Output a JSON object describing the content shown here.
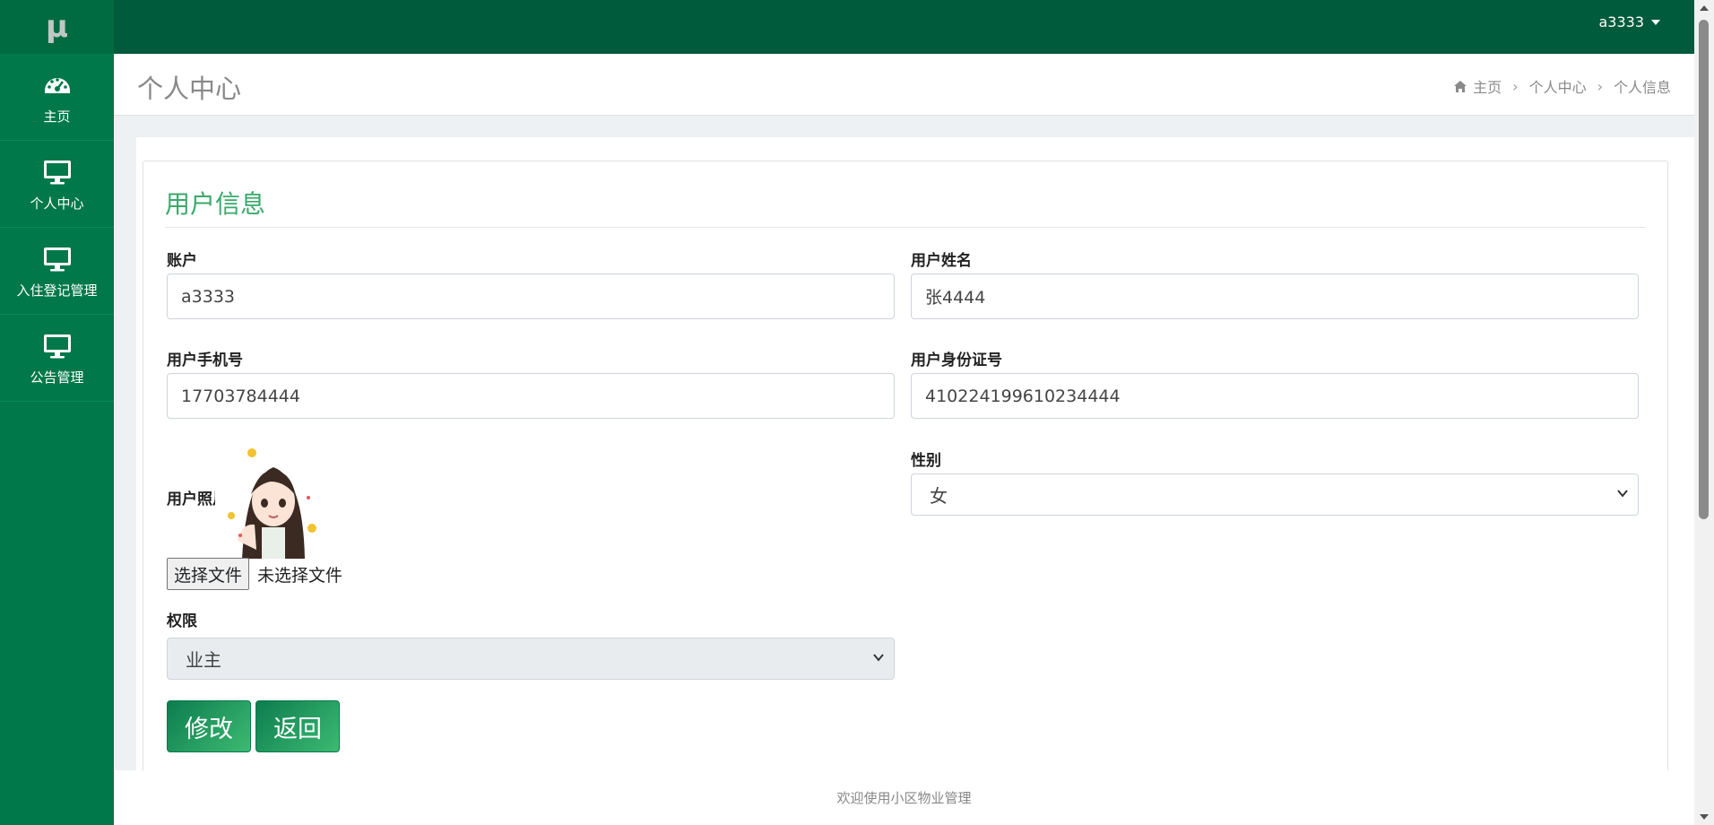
{
  "brand": {
    "logo": "μ"
  },
  "sidebar": {
    "items": [
      {
        "label": "主页",
        "icon": "dashboard-icon"
      },
      {
        "label": "个人中心",
        "icon": "monitor-icon"
      },
      {
        "label": "入住登记管理",
        "icon": "monitor-icon"
      },
      {
        "label": "公告管理",
        "icon": "monitor-icon"
      }
    ]
  },
  "topbar": {
    "username": "a3333"
  },
  "header": {
    "title": "个人中心",
    "breadcrumb": [
      "主页",
      "个人中心",
      "个人信息"
    ]
  },
  "form": {
    "title": "用户信息",
    "account_label": "账户",
    "account_value": "a3333",
    "name_label": "用户姓名",
    "name_value": "张4444",
    "phone_label": "用户手机号",
    "phone_value": "17703784444",
    "idcard_label": "用户身份证号",
    "idcard_value": "410224199610234444",
    "photo_label": "用户照片",
    "file_button": "选择文件",
    "file_status": "未选择文件",
    "gender_label": "性别",
    "gender_value": "女",
    "role_label": "权限",
    "role_value": "业主",
    "submit_label": "修改",
    "back_label": "返回"
  },
  "footer": {
    "text": "欢迎使用小区物业管理"
  },
  "colors": {
    "sidebar": "#007849",
    "topbar": "#005a3c",
    "accent": "#3aaa6b"
  }
}
